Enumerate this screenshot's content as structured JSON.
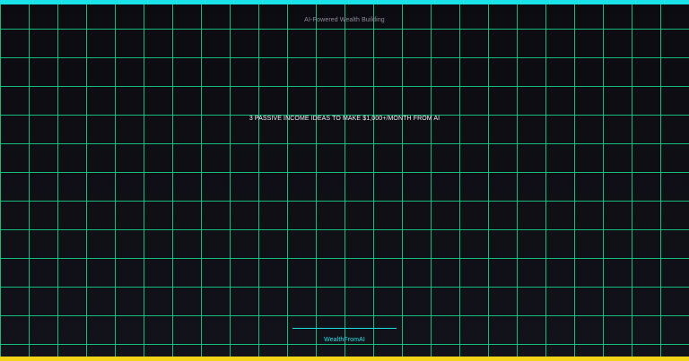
{
  "slide": {
    "subtitle": "AI-Powered Wealth Building",
    "headline": "3 PASSIVE INCOME IDEAS TO MAKE $1,000+/MONTH FROM AI",
    "brand": "WealthFromAI"
  },
  "colors": {
    "background": "#0d0c12",
    "grid_line": "#19d98d",
    "accent_cyan": "#19e3e8",
    "accent_yellow": "#f3d417",
    "subtitle_text": "#8f8f9a",
    "headline_text": "#f2f2f5"
  }
}
